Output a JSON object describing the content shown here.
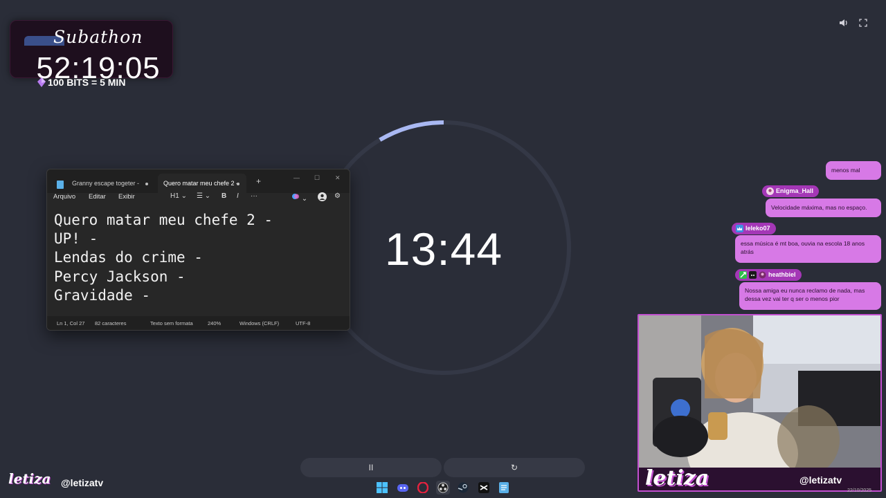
{
  "overlay": {
    "subathon_title": "Subathon",
    "subathon_timer": "52:19:05",
    "bits_text": "100 BITS = 5 MIN",
    "brand_name": "letiza",
    "handle": "@letizatv"
  },
  "focus_timer": {
    "time": "13:44",
    "progress_fraction": 0.085,
    "pause_label": "II",
    "reset_label": "↻"
  },
  "notepad": {
    "tabs": [
      {
        "label": "Granny escape togeter -"
      },
      {
        "label": "Quero matar meu chefe 2 -"
      }
    ],
    "new_tab_label": "+",
    "menus": [
      "Arquivo",
      "Editar",
      "Exibir"
    ],
    "toolbar": {
      "heading": "H1",
      "bold": "B",
      "italic": "I",
      "more": "···"
    },
    "lines": [
      "Quero matar meu chefe 2 -",
      "UP! -",
      "Lendas do crime -",
      "Percy Jackson -",
      "Gravidade -"
    ],
    "status": {
      "position": "Ln 1, Col 27",
      "chars": "82 caracteres",
      "format": "Texto sem formata",
      "zoom": "240%",
      "line_ending": "Windows (CRLF)",
      "encoding": "UTF-8"
    }
  },
  "chat": [
    {
      "user": "",
      "text": "menos mal"
    },
    {
      "user": "Enigma_Hall",
      "text": "Velocidade máxima, mas no espaço."
    },
    {
      "user": "leleko07",
      "text": "essa música é mt boa, ouvia na escola 18 anos atrás"
    },
    {
      "user": "heathbiel",
      "text": "Nossa amiga eu nunca reclamo de nada, mas dessa vez vai ter q ser o menos pior"
    }
  ],
  "taskbar": {
    "icons": [
      "windows-start-icon",
      "discord-icon",
      "opera-gx-icon",
      "obs-icon",
      "steam-icon",
      "capcut-icon",
      "notepad-icon"
    ],
    "date": "22/10/2025"
  },
  "colors": {
    "background": "#2a2d38",
    "chat_bubble": "#d779e6",
    "username_tag": "#a437b6",
    "ring_progress": "#a9b8f2",
    "ring_track": "#343846"
  }
}
